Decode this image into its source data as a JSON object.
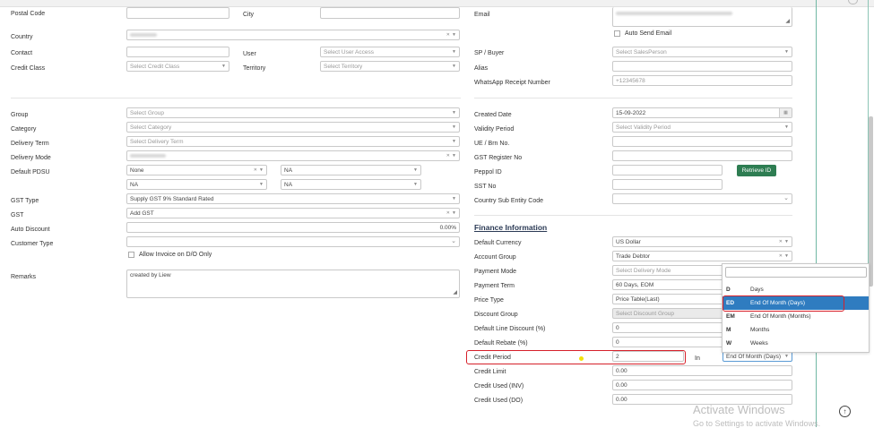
{
  "left": {
    "postal_code_label": "Postal Code",
    "city_label": "City",
    "country_label": "Country",
    "contact_label": "Contact",
    "user_label": "User",
    "user_placeholder": "Select User Access",
    "credit_class_label": "Credit Class",
    "credit_class_placeholder": "Select Credit Class",
    "territory_label": "Territory",
    "territory_placeholder": "Select Territory",
    "group_label": "Group",
    "group_placeholder": "Select Group",
    "category_label": "Category",
    "category_placeholder": "Select Category",
    "delivery_term_label": "Delivery Term",
    "delivery_term_placeholder": "Select Delivery Term",
    "delivery_mode_label": "Delivery Mode",
    "default_pdsu_label": "Default PDSU",
    "pdsu_1": "None",
    "pdsu_2": "NA",
    "pdsu_3": "NA",
    "pdsu_4": "NA",
    "gst_type_label": "GST Type",
    "gst_type_value": "Supply GST 9% Standard Rated",
    "gst_label": "GST",
    "gst_value": "Add GST",
    "auto_discount_label": "Auto Discount",
    "auto_discount_value": "0.00%",
    "customer_type_label": "Customer Type",
    "allow_invoice_label": "Allow Invoice on D/O Only",
    "remarks_label": "Remarks",
    "remarks_value": "created by Liew"
  },
  "right": {
    "email_label": "Email",
    "auto_send_email_label": "Auto Send Email",
    "sp_buyer_label": "SP / Buyer",
    "sp_buyer_placeholder": "Select SalesPerson",
    "alias_label": "Alias",
    "whatsapp_label": "WhatsApp Receipt Number",
    "whatsapp_placeholder": "+12345678",
    "created_date_label": "Created Date",
    "created_date_value": "15-09-2022",
    "validity_period_label": "Validity Period",
    "validity_period_placeholder": "Select Validity Period",
    "ue_label": "UE / Brn No.",
    "gst_register_label": "GST Register No",
    "peppol_label": "Peppol ID",
    "retrieve_id_label": "Retrieve ID",
    "sst_label": "SST No",
    "country_sub_entity_label": "Country Sub Entity Code",
    "finance_title": "Finance Information",
    "default_currency_label": "Default Currency",
    "default_currency_value": "US Dollar",
    "account_group_label": "Account Group",
    "account_group_value": "Trade Debtor",
    "payment_mode_label": "Payment Mode",
    "payment_mode_placeholder": "Select Delivery Mode",
    "payment_term_label": "Payment Term",
    "payment_term_value": "60 Days, EOM",
    "price_type_label": "Price Type",
    "price_type_value": "Price Table(Last)",
    "discount_group_label": "Discount Group",
    "discount_group_placeholder": "Select Discount Group",
    "default_line_discount_label": "Default Line Discount (%)",
    "default_line_discount_value": "0",
    "default_rebate_label": "Default Rebate (%)",
    "default_rebate_value": "0",
    "credit_period_label": "Credit Period",
    "credit_period_value": "2",
    "in_label": "In",
    "credit_period_unit": "End Of Month (Days)",
    "credit_limit_label": "Credit Limit",
    "credit_limit_value": "0.00",
    "credit_used_inv_label": "Credit Used (INV)",
    "credit_used_inv_value": "0.00",
    "credit_used_do_label": "Credit Used (DO)",
    "credit_used_do_value": "0.00"
  },
  "dropdown": {
    "items": [
      {
        "code": "D",
        "name": "Days"
      },
      {
        "code": "ED",
        "name": "End Of Month (Days)"
      },
      {
        "code": "EM",
        "name": "End Of Month (Months)"
      },
      {
        "code": "M",
        "name": "Months"
      },
      {
        "code": "W",
        "name": "Weeks"
      }
    ]
  },
  "watermark": {
    "line1": "Activate Windows",
    "line2": "Go to Settings to activate Windows."
  },
  "icons": {
    "dropdown_arrow": "caret-down-icon",
    "clear": "clear-x-icon",
    "calendar": "calendar-icon",
    "scroll_top": "arrow-up-circle-icon",
    "chevron": "chevron-down-icon"
  },
  "colors": {
    "highlight_red": "#d6202a",
    "selected_blue": "#2f7cc0",
    "retrieve_green": "#2e7d52",
    "section_title": "#2b3a55"
  }
}
